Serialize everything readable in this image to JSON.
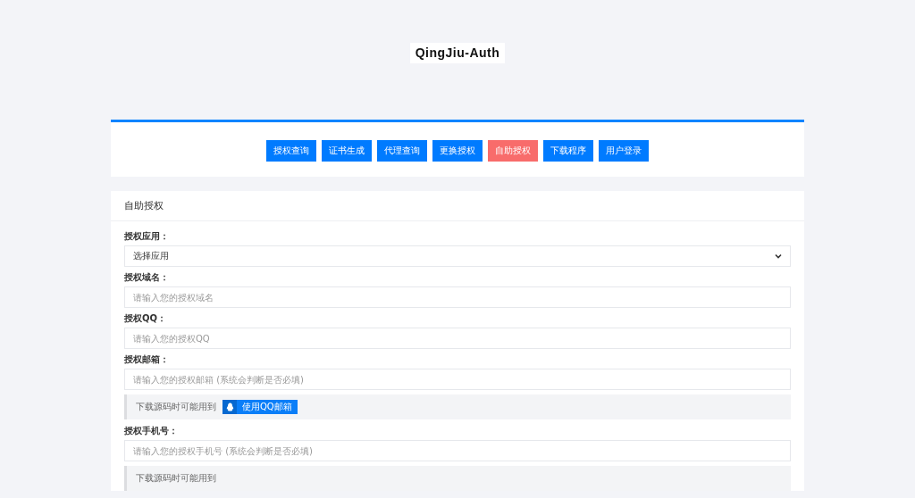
{
  "logo": {
    "text": "QingJiu-Auth"
  },
  "nav": [
    {
      "label": "授权查询",
      "selected": false
    },
    {
      "label": "证书生成",
      "selected": false
    },
    {
      "label": "代理查询",
      "selected": false
    },
    {
      "label": "更换授权",
      "selected": false
    },
    {
      "label": "自助授权",
      "selected": true
    },
    {
      "label": "下载程序",
      "selected": false
    },
    {
      "label": "用户登录",
      "selected": false
    }
  ],
  "panel": {
    "title": "自助授权",
    "items": [
      {
        "kind": "select",
        "label": "授权应用：",
        "value": "选择应用"
      },
      {
        "kind": "input",
        "label": "授权域名：",
        "placeholder": "请输入您的授权域名"
      },
      {
        "kind": "input",
        "label": "授权QQ：",
        "placeholder": "请输入您的授权QQ"
      },
      {
        "kind": "input",
        "label": "授权邮箱：",
        "placeholder": "请输入您的授权邮箱 (系统会判断是否必填)"
      },
      {
        "kind": "note",
        "text": "下载源码时可能用到",
        "button": "使用QQ邮箱"
      },
      {
        "kind": "input",
        "label": "授权手机号：",
        "placeholder": "请输入您的授权手机号 (系统会判断是否必填)"
      },
      {
        "kind": "note",
        "text": "下载源码时可能用到"
      }
    ]
  }
}
